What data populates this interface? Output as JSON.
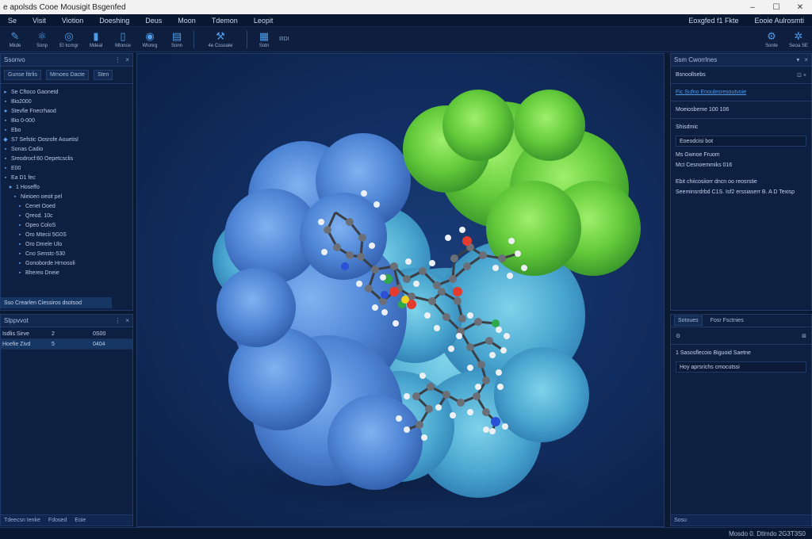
{
  "window": {
    "title": "e apolsds Cooe Mousigit Bsgenfed",
    "min": "–",
    "max": "☐",
    "close": "✕"
  },
  "menu": [
    "Se",
    "Visit",
    "Viotion",
    "Doeshing",
    "Deus",
    "Moon",
    "Tdemon",
    "Leopit"
  ],
  "menu_right": [
    "Eoxgfed f1 Fkte",
    "Eooie Aulrosmti"
  ],
  "toolbar": {
    "left": [
      {
        "icon": "pen-icon",
        "glyph": "✎",
        "label": "Mkde"
      },
      {
        "icon": "molecule-icon",
        "glyph": "⚛",
        "label": "Sonp"
      },
      {
        "icon": "orbit-icon",
        "glyph": "◎",
        "label": "EI kcmgr"
      },
      {
        "icon": "document-icon",
        "glyph": "▮",
        "label": "Mdeal"
      },
      {
        "icon": "file-icon",
        "glyph": "▯",
        "label": "Mtonce"
      },
      {
        "icon": "camera-icon",
        "glyph": "◉",
        "label": "Wlonrg"
      },
      {
        "icon": "page-icon",
        "glyph": "▤",
        "label": "Sonn"
      },
      {
        "icon": "wrench-icon",
        "glyph": "⚒",
        "label": "4e Cssoaiw"
      },
      {
        "icon": "grid-icon",
        "glyph": "▦",
        "label": "Sotn"
      }
    ],
    "grid_label": "IlIDI",
    "right": [
      {
        "icon": "tool-icon",
        "glyph": "⚙",
        "label": "Sonte"
      },
      {
        "icon": "settings-icon",
        "glyph": "✲",
        "label": "Seoa SE"
      }
    ]
  },
  "left_panel": {
    "title": "Ssonvo",
    "tabs": [
      "Gunse fitrlis",
      "Mrnoeo Dacte",
      "Sten"
    ],
    "tree": [
      {
        "icon": "expand-icon",
        "glyph": "▸",
        "text": "Se Cftoco Gaonetd"
      },
      {
        "icon": "item-icon",
        "glyph": "▪",
        "text": "Bio2000"
      },
      {
        "icon": "item-icon",
        "glyph": "●",
        "text": "Stevfie Fnecrhaod"
      },
      {
        "icon": "item-icon",
        "glyph": "▪",
        "text": "Bio 0-000"
      },
      {
        "icon": "item-icon",
        "glyph": "▪",
        "text": "Ebo"
      },
      {
        "icon": "item-icon",
        "glyph": "◆",
        "text": "S7 Sefstic Oosrofe Aouetisl"
      },
      {
        "icon": "item-icon",
        "glyph": "▪",
        "text": "Sonas Cadio"
      },
      {
        "icon": "item-icon",
        "glyph": "▪",
        "text": "Sreodrocf:60 Oepetcsclis"
      },
      {
        "icon": "item-icon",
        "glyph": "▪",
        "text": "E00"
      },
      {
        "icon": "item-icon",
        "glyph": "▪",
        "text": "Ea D1 fec"
      },
      {
        "icon": "item-icon",
        "glyph": "●",
        "text": "1 Hoseffo"
      },
      {
        "icon": "item-icon",
        "glyph": "▪",
        "text": "Nieioen oeoit pel"
      },
      {
        "icon": "item-icon",
        "glyph": "▪",
        "text": "Cenet Ooed"
      },
      {
        "icon": "item-icon",
        "glyph": "▪",
        "text": "Qreod. 10c"
      },
      {
        "icon": "item-icon",
        "glyph": "▪",
        "text": "Opeo ColoS"
      },
      {
        "icon": "item-icon",
        "glyph": "▪",
        "text": "Oro Mtecii 5G0S"
      },
      {
        "icon": "item-icon",
        "glyph": "▪",
        "text": "Oro Dmele Ulo"
      },
      {
        "icon": "item-icon",
        "glyph": "▪",
        "text": "Cno Senstc-530"
      },
      {
        "icon": "item-icon",
        "glyph": "▪",
        "text": "Gonoborde Hrnosoli"
      },
      {
        "icon": "item-icon",
        "glyph": "▪",
        "text": "Bhereo Dneie"
      }
    ],
    "selected_row": "Sso Crearlen Ciessiros dsotsod"
  },
  "left_lower_panel": {
    "title": "Slppvvot",
    "rows": [
      {
        "name": "Isdlis Sirve",
        "count": "2",
        "val": "0S00"
      },
      {
        "name": "Hoefie Zivd",
        "count": "5",
        "val": "0404"
      }
    ],
    "footer": [
      "Tdeecsn Ienke",
      "Fdosed",
      "Eoie"
    ]
  },
  "right_panel": {
    "title": "Ssm Cworrlnes",
    "subtitle": "Bsnoollsebs",
    "highlight": "Fic Sufno Enoulesresoutvoie",
    "info_line": "Moeiosbeme 100 106",
    "section": "Shisdmic",
    "field": "Eoeodcisi bot",
    "props": [
      "Ms Gwnoe Fruom",
      "Mct Cesnoemmiks 016"
    ],
    "note_1": "Ebit chiicosiiorr dncn oo reosrstie",
    "note_2": "Seeminsrdrbd C1S. Isf2 erssiaserr B. A D Texisp",
    "lower_tabs": [
      "Sotoues",
      "Fosr Fsctnies"
    ],
    "lower_title": "1 Sasosflecoio Biguoid Saetne",
    "lower_field": "Hoy aprsrichs cmocutssi",
    "footer": "Sosu"
  },
  "status": {
    "text": "Mosdo 0. Dtlmdo 2G3T3S0"
  },
  "colors": {
    "accent": "#4f9be8",
    "panel": "#0e2042",
    "protein_blue": "#5a8fdc",
    "protein_green": "#6ccf3f"
  }
}
